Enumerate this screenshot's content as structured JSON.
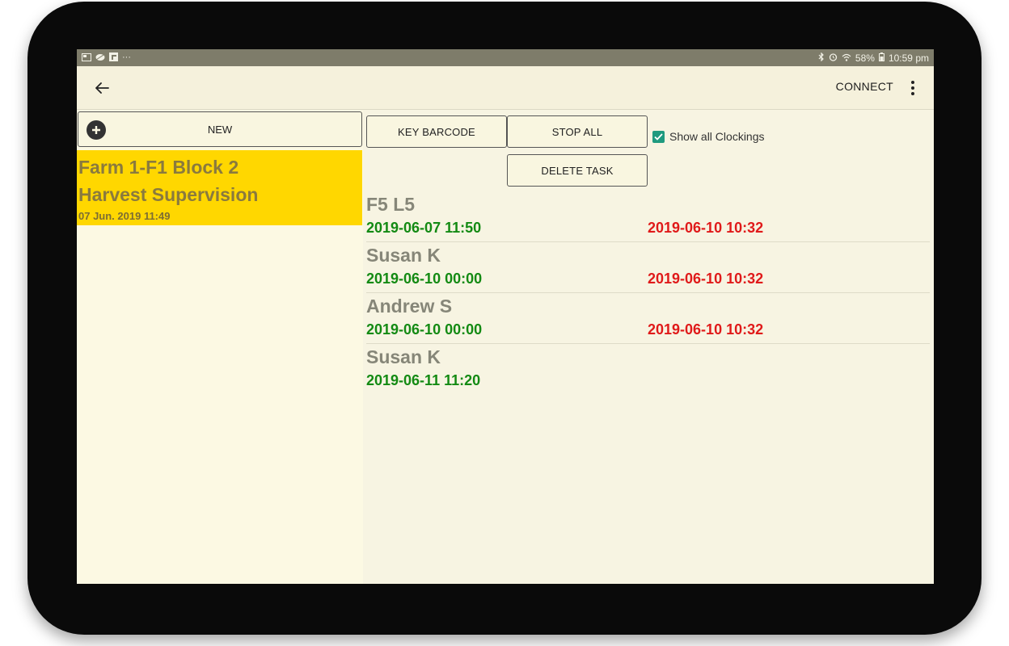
{
  "status_bar": {
    "left_icons": [
      "screenshot-icon",
      "leaf-icon",
      "flipboard-icon"
    ],
    "more_glyph": "···",
    "battery": "58%",
    "time": "10:59 pm"
  },
  "action_bar": {
    "connect_label": "CONNECT"
  },
  "left_pane": {
    "new_label": "NEW",
    "tasks": [
      {
        "title_line1": "Farm 1-F1 Block 2",
        "title_line2": "Harvest Supervision",
        "timestamp": "07 Jun. 2019 11:49"
      }
    ]
  },
  "right_pane": {
    "key_barcode_label": "KEY BARCODE",
    "stop_all_label": "STOP ALL",
    "delete_task_label": "DELETE TASK",
    "show_all_label": "Show all Clockings",
    "show_all_checked": true,
    "clockings": [
      {
        "name": "F5 L5",
        "clock_in": "2019-06-07 11:50",
        "clock_out": "2019-06-10 10:32"
      },
      {
        "name": "Susan K",
        "clock_in": "2019-06-10 00:00",
        "clock_out": "2019-06-10 10:32"
      },
      {
        "name": "Andrew S",
        "clock_in": "2019-06-10 00:00",
        "clock_out": "2019-06-10 10:32"
      },
      {
        "name": "Susan K",
        "clock_in": "2019-06-11 11:20",
        "clock_out": ""
      }
    ]
  },
  "colors": {
    "accent_yellow": "#ffd700",
    "clock_in_green": "#138a13",
    "clock_out_red": "#e01a1a",
    "checkbox_teal": "#1f9a7f"
  }
}
